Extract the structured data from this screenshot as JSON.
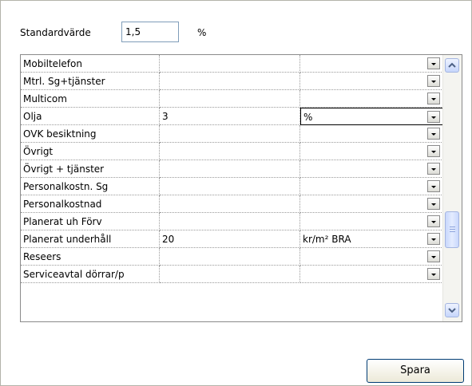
{
  "standard": {
    "label": "Standardvärde",
    "value": "1,5",
    "unit": "%"
  },
  "rows": [
    {
      "name": "Mobiltelefon",
      "value": "",
      "unit": ""
    },
    {
      "name": "Mtrl. Sg+tjänster",
      "value": "",
      "unit": ""
    },
    {
      "name": "Multicom",
      "value": "",
      "unit": ""
    },
    {
      "name": "Olja",
      "value": "3",
      "unit": "%"
    },
    {
      "name": "OVK besiktning",
      "value": "",
      "unit": ""
    },
    {
      "name": "Övrigt",
      "value": "",
      "unit": ""
    },
    {
      "name": "Övrigt + tjänster",
      "value": "",
      "unit": ""
    },
    {
      "name": "Personalkostn. Sg",
      "value": "",
      "unit": ""
    },
    {
      "name": "Personalkostnad",
      "value": "",
      "unit": ""
    },
    {
      "name": "Planerat uh Förv",
      "value": "",
      "unit": ""
    },
    {
      "name": "Planerat underhåll",
      "value": "20",
      "unit": "kr/m² BRA"
    },
    {
      "name": "Reseers",
      "value": "",
      "unit": ""
    },
    {
      "name": "Serviceavtal dörrar/p",
      "value": "",
      "unit": ""
    }
  ],
  "focused_row_index": 3,
  "save_label": "Spara"
}
